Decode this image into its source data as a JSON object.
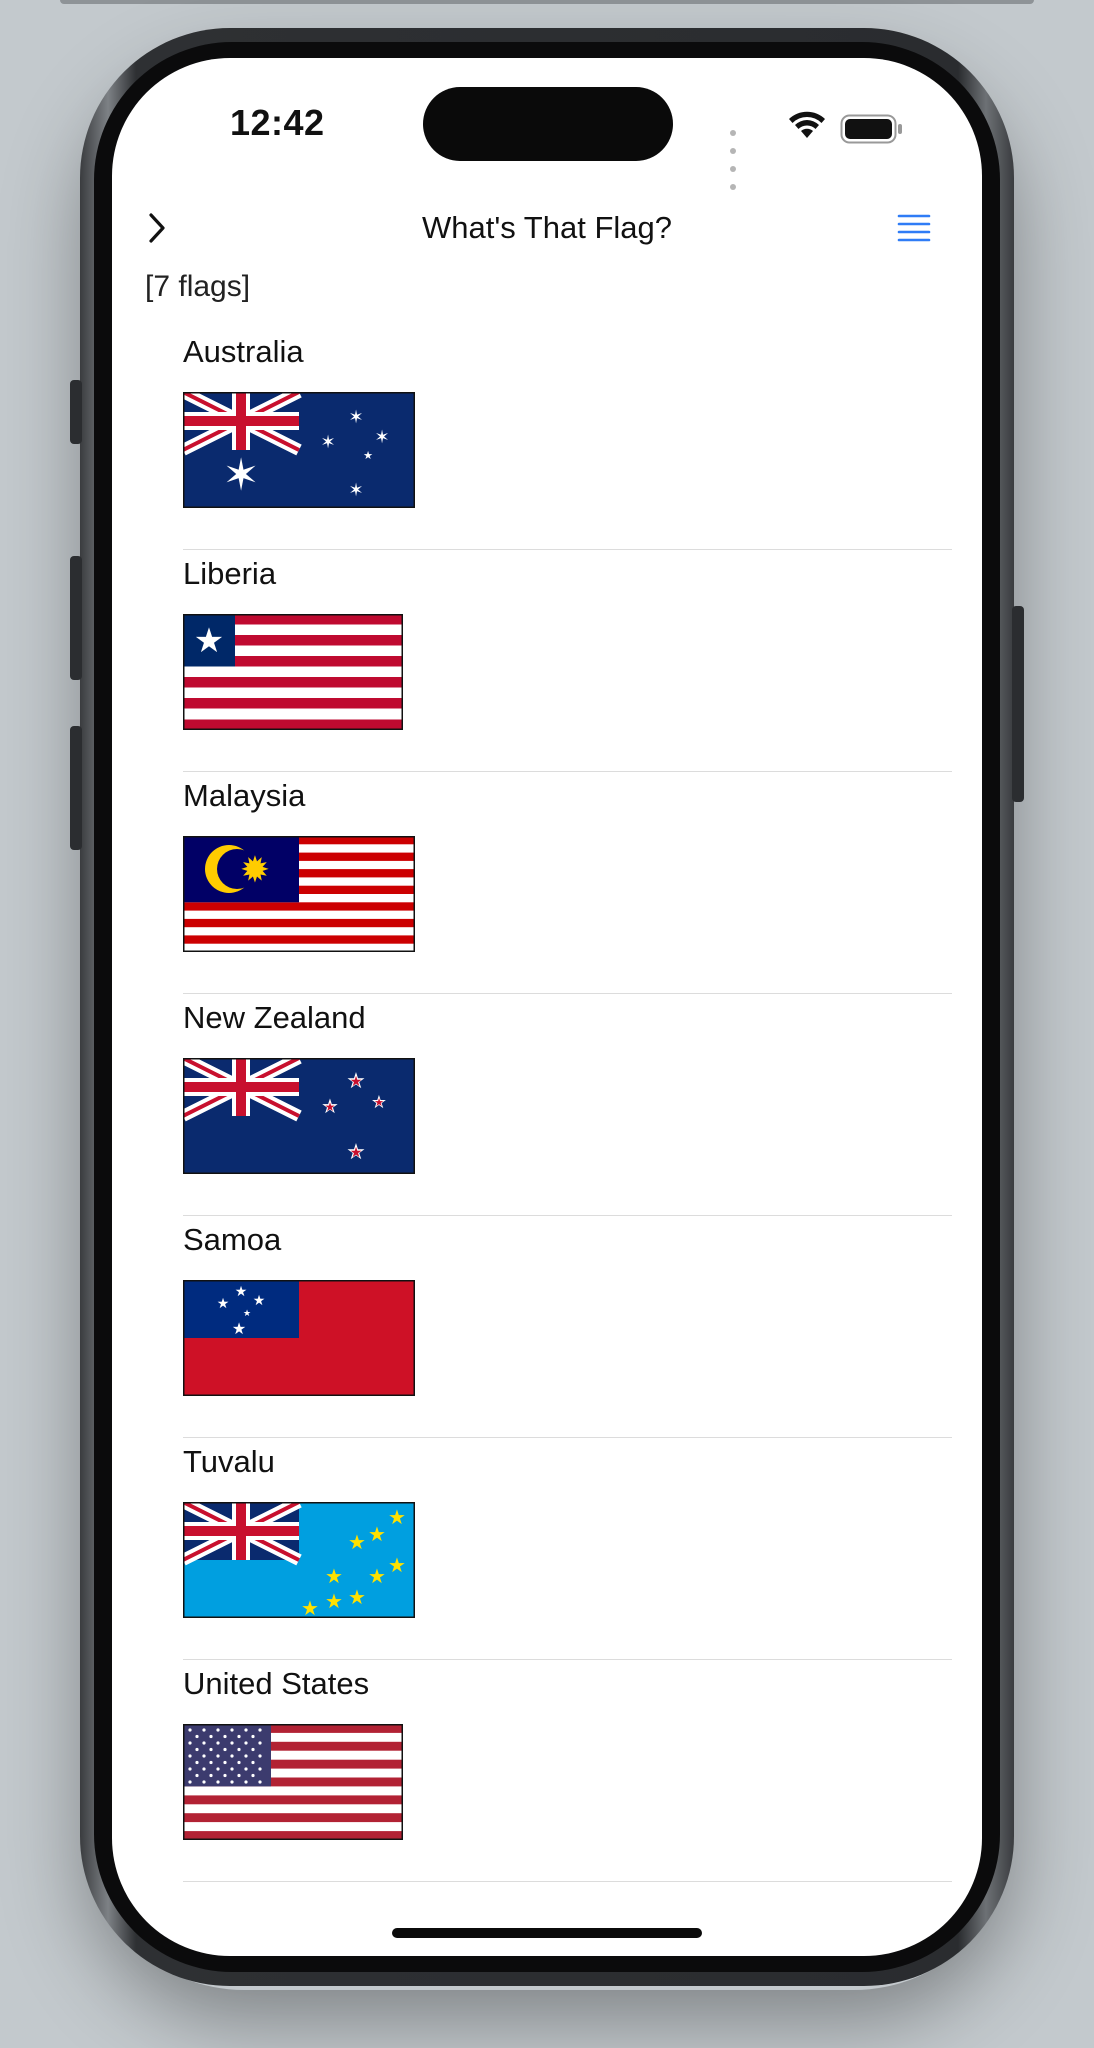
{
  "status_bar": {
    "time": "12:42"
  },
  "nav": {
    "title": "What's That Flag?",
    "back_icon": "chevron-right-icon",
    "menu_icon": "list-icon",
    "accent": "#2F7CF6"
  },
  "summary": {
    "count_label": "[7 flags]"
  },
  "flags": [
    {
      "name": "Australia"
    },
    {
      "name": "Liberia"
    },
    {
      "name": "Malaysia"
    },
    {
      "name": "New Zealand"
    },
    {
      "name": "Samoa"
    },
    {
      "name": "Tuvalu"
    },
    {
      "name": "United States"
    }
  ]
}
